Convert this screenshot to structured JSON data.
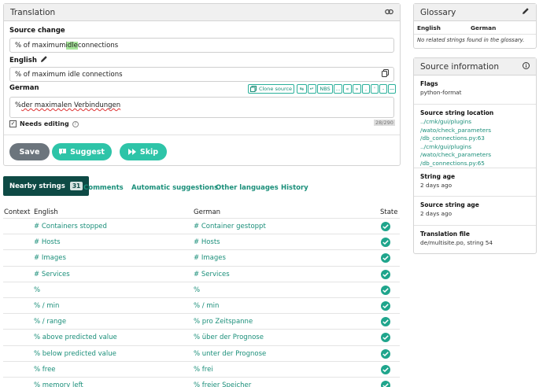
{
  "translation": {
    "title": "Translation",
    "link_icon": "link-icon",
    "source_label": "Source change",
    "source_before": "% of maximum ",
    "source_highlight": "idle",
    "source_after": " connections",
    "english_label": "English",
    "english_value": "% of maximum idle connections",
    "german_label": "German",
    "german_prefix": "% ",
    "german_wavy": "der maximalen Verbindungen",
    "clone_label": "Clone source",
    "tool_nbs": "NBS",
    "tool_ellipsis": "…",
    "tool_ldquo": "«",
    "tool_rdquo": "»",
    "tool_comma": ",",
    "tool_apos": "'",
    "tool_dash": "-",
    "tool_emdash": "—",
    "char_count": "28/290",
    "needs_editing": "Needs editing",
    "save": "Save",
    "suggest": "Suggest",
    "skip": "Skip",
    "accent": "#2ec4a8",
    "save_color": "#6c757d"
  },
  "tabs": {
    "nearby": "Nearby strings",
    "nearby_count": "31",
    "comments": "Comments",
    "automatic": "Automatic suggestions",
    "other": "Other languages",
    "history": "History"
  },
  "table": {
    "headers": [
      "Context",
      "English",
      "German",
      "State"
    ],
    "rows": [
      {
        "en": "# Containers stopped",
        "de": "# Container gestoppt"
      },
      {
        "en": "# Hosts",
        "de": "# Hosts"
      },
      {
        "en": "# Images",
        "de": "# Images"
      },
      {
        "en": "# Services",
        "de": "# Services"
      },
      {
        "en": "%",
        "de": "%"
      },
      {
        "en": "% / min",
        "de": "% / min"
      },
      {
        "en": "% / range",
        "de": "% pro Zeitspanne"
      },
      {
        "en": "% above predicted value",
        "de": "% über der Prognose"
      },
      {
        "en": "% below predicted value",
        "de": "% unter der Prognose"
      },
      {
        "en": "% free",
        "de": "% frei"
      },
      {
        "en": "% memory left",
        "de": "% freier Speicher"
      }
    ]
  },
  "glossary": {
    "title": "Glossary",
    "col_en": "English",
    "col_de": "German",
    "empty": "No related strings found in the glossary."
  },
  "source_info": {
    "title": "Source information",
    "flags_label": "Flags",
    "flags_value": "python-format",
    "location_label": "Source string location",
    "location_lines": [
      "../cmk/gui/plugins",
      "/wato/check_parameters",
      "/db_connections.py:63 ../cmk/gui/plugins",
      "/wato/check_parameters",
      "/db_connections.py:65"
    ],
    "age_label": "String age",
    "age_value": "2 days ago",
    "src_age_label": "Source string age",
    "src_age_value": "2 days ago",
    "file_label": "Translation file",
    "file_value": "de/multisite.po, string 54"
  }
}
